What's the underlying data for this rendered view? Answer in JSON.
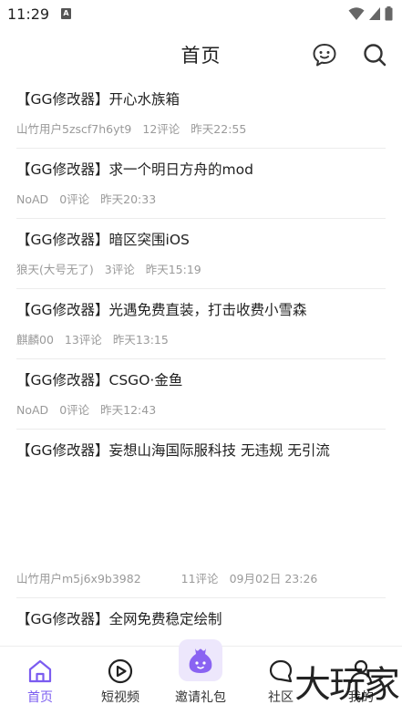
{
  "status_bar": {
    "time": "11:29",
    "notification_letter": "A"
  },
  "header": {
    "title": "首页"
  },
  "posts": [
    {
      "title": "【GG修改器】开心水族箱",
      "author": "山竹用户5zscf7h6yt9",
      "comments": "12评论",
      "time": "昨天22:55"
    },
    {
      "title": "【GG修改器】求一个明日方舟的mod",
      "author": "NoAD",
      "comments": "0评论",
      "time": "昨天20:33"
    },
    {
      "title": "【GG修改器】暗区突围iOS",
      "author": "狼天(大号无了)",
      "comments": "3评论",
      "time": "昨天15:19"
    },
    {
      "title": "【GG修改器】光遇免费直装，打击收费小雪森",
      "author": "麒麟00",
      "comments": "13评论",
      "time": "昨天13:15"
    },
    {
      "title": "【GG修改器】CSGO·金鱼",
      "author": "NoAD",
      "comments": "0评论",
      "time": "昨天12:43"
    },
    {
      "title": "【GG修改器】妄想山海国际服科技  无违规  无引流",
      "author": "山竹用户m5j6x9b3982",
      "comments": "11评论",
      "time": "09月02日 23:26"
    },
    {
      "title": "【GG修改器】全网免费稳定绘制",
      "author": "",
      "comments": "",
      "time": ""
    }
  ],
  "tabs": [
    {
      "label": "首页",
      "icon": "home-icon",
      "active": true
    },
    {
      "label": "短视频",
      "icon": "play-icon",
      "active": false
    },
    {
      "label": "邀请礼包",
      "icon": "gift-bag-icon",
      "active": false
    },
    {
      "label": "社区",
      "icon": "chat-icon",
      "active": false
    },
    {
      "label": "我的",
      "icon": "user-icon",
      "active": false
    }
  ],
  "watermark": "大玩家",
  "colors": {
    "accent": "#7b5cf0",
    "text": "#222222",
    "meta": "#9a9a9a",
    "gift_bg": "#ede7fc"
  }
}
